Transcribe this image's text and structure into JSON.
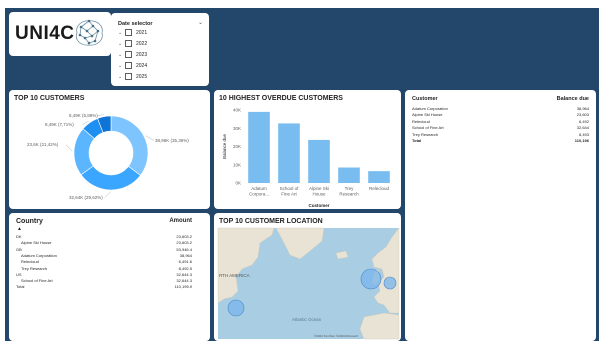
{
  "logo": {
    "text": "UNI4C"
  },
  "date_selector": {
    "title": "Date selector",
    "years": [
      "2021",
      "2022",
      "2023",
      "2024",
      "2025"
    ]
  },
  "top10": {
    "title": "TOP 10 CUSTOMERS",
    "slices": [
      {
        "label": "38,96K (35,36%)",
        "value": 35.36,
        "color": "#7ec4ff"
      },
      {
        "label": "32,64K (29,62%)",
        "value": 29.62,
        "color": "#3aa6ff"
      },
      {
        "label": "23,6K (21,42%)",
        "value": 21.42,
        "color": "#5cb6ff"
      },
      {
        "label": "8,49K (7,71%)",
        "value": 7.71,
        "color": "#1f90f2"
      },
      {
        "label": "6,49K (5,89%)",
        "value": 5.89,
        "color": "#0e74d6"
      }
    ]
  },
  "chart_data": {
    "type": "bar",
    "title": "10 HIGHEST OVERDUE CUSTOMERS",
    "xlabel": "Customer",
    "ylabel": "Balance due",
    "categories": [
      "Adatum Corpora...",
      "School of Fine Art",
      "Alpine Ski House",
      "Trey Research",
      "Relecloud"
    ],
    "category_lines": [
      [
        "Adatum",
        "Corpora..."
      ],
      [
        "School of",
        "Fine Art"
      ],
      [
        "Alpine Ski",
        "House"
      ],
      [
        "Trey",
        "Research"
      ],
      [
        "Relecloud"
      ]
    ],
    "values": [
      38964,
      32644,
      23603,
      8493,
      6492
    ],
    "ylim": [
      0,
      40000
    ],
    "yticks": [
      "0K",
      "10K",
      "20K",
      "30K",
      "40K"
    ],
    "bar_color": "#78bcf0"
  },
  "balance_table": {
    "headers": [
      "Customer",
      "Balance due"
    ],
    "rows": [
      [
        "Adatum Corporation",
        "38,964"
      ],
      [
        "Alpine Ski House",
        "23,603"
      ],
      [
        "Relecloud",
        "6,492"
      ],
      [
        "School of Fine Art",
        "32,644"
      ],
      [
        "Trey Research",
        "8,493"
      ]
    ],
    "total": [
      "Total",
      "110,196"
    ]
  },
  "country_table": {
    "headers": [
      "Country",
      "Amount"
    ],
    "sort_indicator": "▲",
    "rows": [
      {
        "label": "DK",
        "value": "23,603.2",
        "indent": false
      },
      {
        "label": "Alpine Ski House",
        "value": "23,603.2",
        "indent": true
      },
      {
        "label": "GB",
        "value": "53,946.4",
        "indent": false
      },
      {
        "label": "Adatum Corporation",
        "value": "38,964",
        "indent": true
      },
      {
        "label": "Relecloud",
        "value": "6,491.6",
        "indent": true
      },
      {
        "label": "Trey Research",
        "value": "8,492.5",
        "indent": true
      },
      {
        "label": "US",
        "value": "32,644.3",
        "indent": false
      },
      {
        "label": "School of Fine Art",
        "value": "32,644.3",
        "indent": true
      },
      {
        "label": "Total",
        "value": "110,195.9",
        "indent": false
      }
    ]
  },
  "map": {
    "title": "TOP 10 CUSTOMER LOCATION",
    "label_america": "RTH AMERICA",
    "label_ocean": "Atlantic Ocean",
    "footer": "©2024 TomTom ©2024 Microsoft",
    "land_color": "#e8e3d4",
    "water_color": "#a9cde3",
    "bubble_color": "#7ab4ec"
  }
}
